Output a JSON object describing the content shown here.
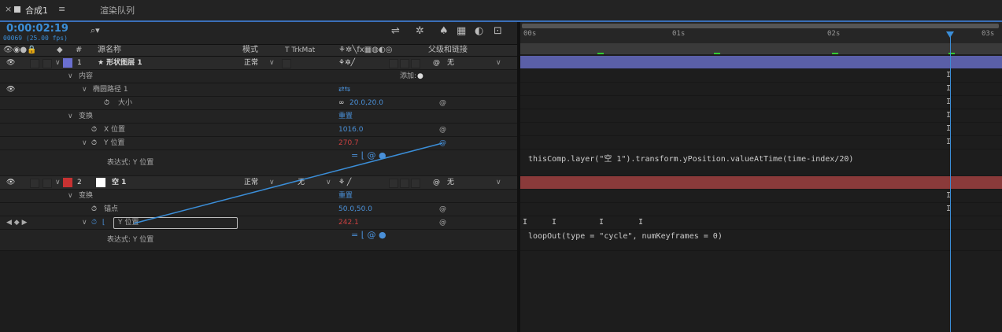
{
  "tabs": {
    "close": "×",
    "comp": "合成1",
    "menu": "≡",
    "render_queue": "渲染队列"
  },
  "controls": {
    "timecode": "0:00:02:19",
    "frames": "00069 (25.00 fps)",
    "search_placeholder": ""
  },
  "columns": {
    "source_name": "源名称",
    "mode": "模式",
    "trkmat": "T TrkMat",
    "parent": "父级和链接",
    "hash": "#"
  },
  "layers": [
    {
      "num": "1",
      "name": "★ 形状图层 1",
      "color": "#6a6fd0",
      "mode": "正常",
      "parent": "无"
    },
    {
      "num": "2",
      "name": "空 1",
      "color": "#c83232",
      "mode": "正常",
      "trkmat": "无",
      "parent": "无"
    }
  ],
  "rows": {
    "contents": "内容",
    "add_label": "添加:",
    "ellipse_path": "椭圆路径 1",
    "size_label": "大小",
    "size_value": "20.0,20.0",
    "transform": "变换",
    "reset": "重置",
    "x_pos_label": "X 位置",
    "x_pos_value": "1016.0",
    "y_pos_label": "Y 位置",
    "y_pos_value": "270.7",
    "expr_label": "表达式: Y 位置",
    "transform2": "变换",
    "reset2": "重置",
    "anchor_label": "锚点",
    "anchor_value": "50.0,50.0",
    "y_pos2_label": "Y 位置",
    "y_pos2_value": "242.1",
    "expr2_label": "表达式: Y 位置"
  },
  "timeline": {
    "ticks": [
      "00s",
      "01s",
      "02s",
      "03s"
    ],
    "expression1": "thisComp.layer(\"空 1\").transform.yPosition.valueAtTime(time-index/20)",
    "expression2": "loopOut(type = \"cycle\", numKeyframes = 0)"
  },
  "colors": {
    "accent": "#3b8ed8",
    "layer1": "#5a5fa8",
    "layer2": "#8a3a3a"
  }
}
